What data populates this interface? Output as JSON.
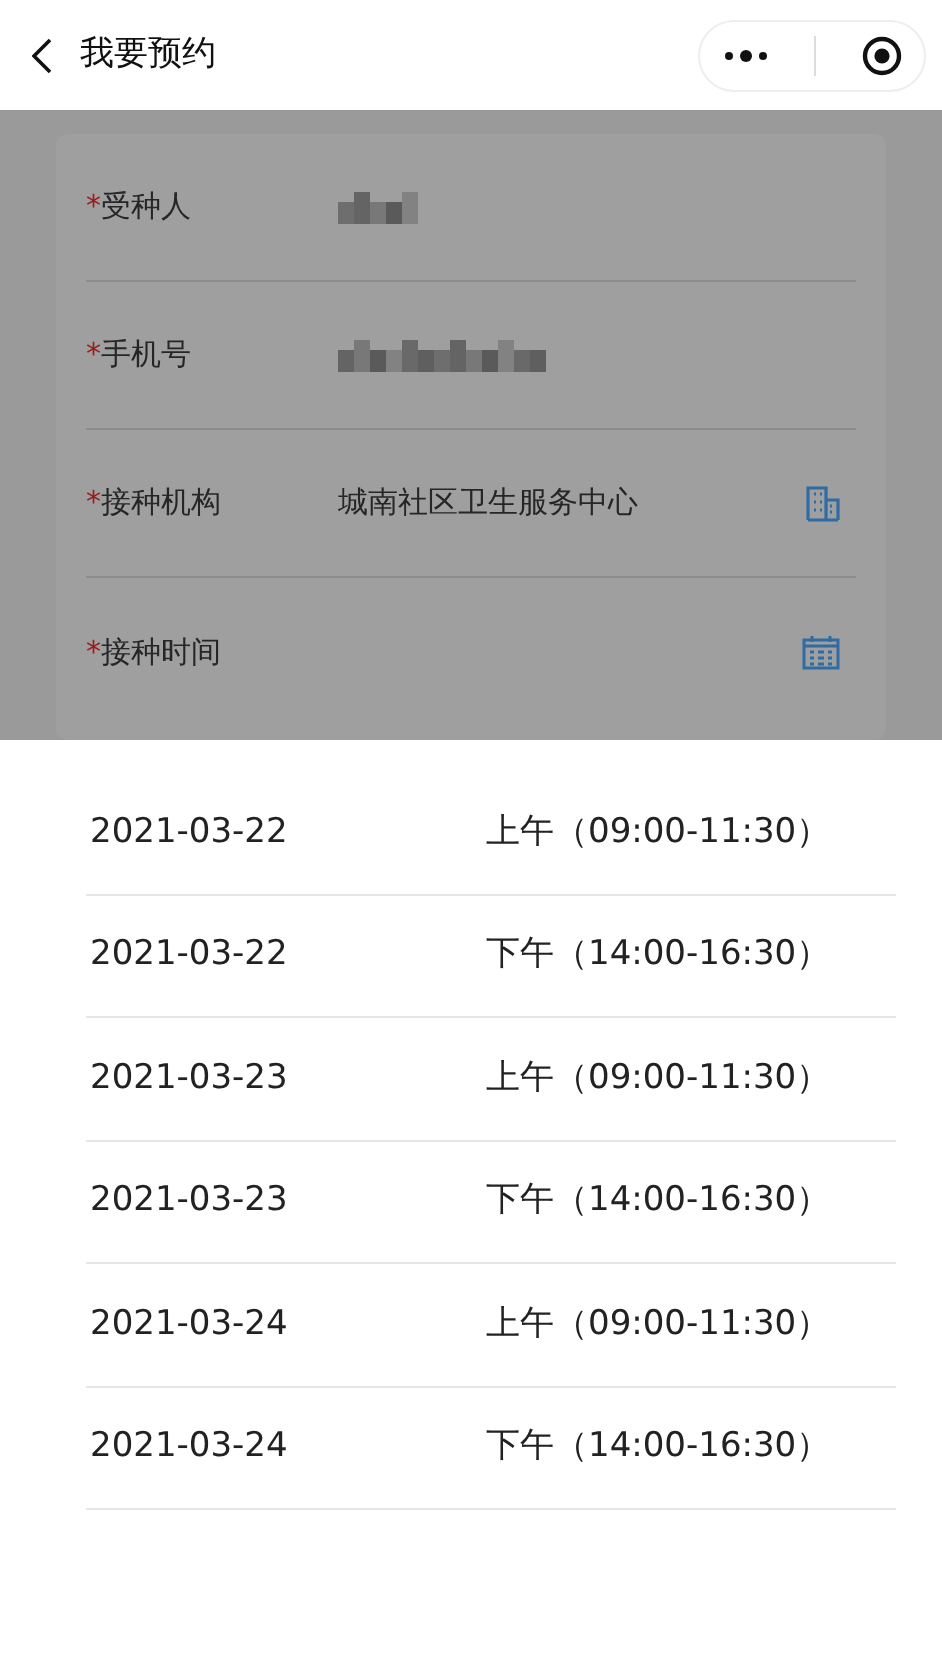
{
  "header": {
    "title": "我要预约"
  },
  "form": {
    "fields": [
      {
        "mark": "*",
        "label": "受种人",
        "kind": "redacted"
      },
      {
        "mark": "*",
        "label": "手机号",
        "kind": "redacted"
      },
      {
        "mark": "*",
        "label": "接种机构",
        "kind": "institution",
        "value": "城南社区卫生服务中心"
      },
      {
        "mark": "*",
        "label": "接种时间",
        "kind": "date"
      }
    ]
  },
  "time_options": [
    {
      "date": "2021-03-22",
      "period": "上午（09:00-11:30）",
      "selected": false
    },
    {
      "date": "2021-03-22",
      "period": "下午（14:00-16:30）",
      "selected": false
    },
    {
      "date": "2021-03-23",
      "period": "上午（09:00-11:30）",
      "selected": false
    },
    {
      "date": "2021-03-23",
      "period": "下午（14:00-16:30）",
      "selected": false
    },
    {
      "date": "2021-03-24",
      "period": "上午（09:00-11:30）",
      "selected": false
    },
    {
      "date": "2021-03-24",
      "period": "下午（14:00-16:30）",
      "selected": false
    }
  ]
}
